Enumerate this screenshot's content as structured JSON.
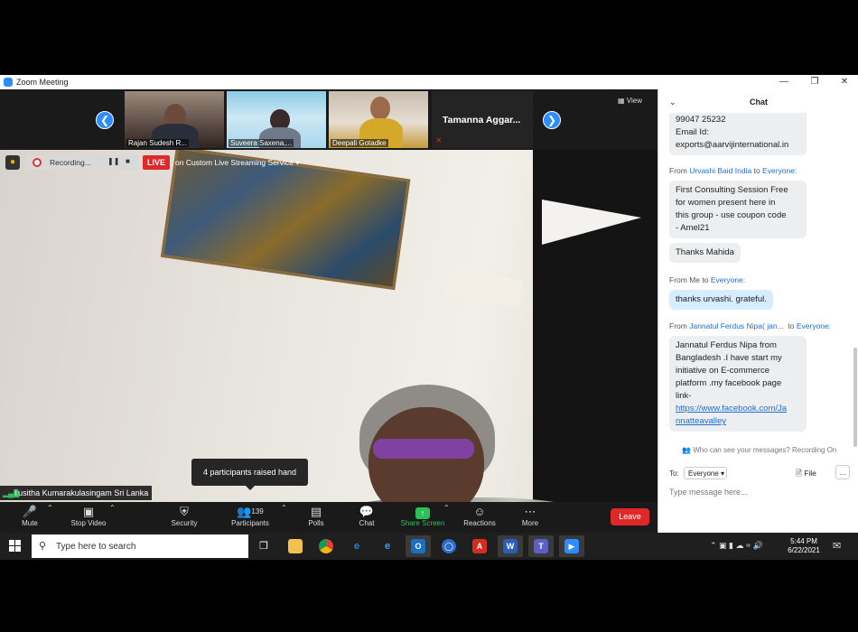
{
  "window": {
    "title": "Zoom Meeting"
  },
  "thumbnails": [
    {
      "name": "Rajan Sudesh R..."
    },
    {
      "name": "Suveera Saxena,..."
    },
    {
      "name": "Deepali Gotadke"
    },
    {
      "name": "Tamanna  Aggar..."
    }
  ],
  "view_label": "View",
  "recording": {
    "label": "Recording...",
    "live": "LIVE",
    "stream": "on Custom Live Streaming Service"
  },
  "active_speaker": "Tusitha Kumarakulasingam Sri Lanka",
  "raised_hand_tooltip": "4 participants raised hand",
  "toolbar": {
    "mute": "Mute",
    "stop_video": "Stop Video",
    "security": "Security",
    "participants": "Participants",
    "participants_count": "139",
    "polls": "Polls",
    "chat": "Chat",
    "share_screen": "Share Screen",
    "reactions": "Reactions",
    "more": "More",
    "leave": "Leave"
  },
  "chat": {
    "title": "Chat",
    "partial_message": {
      "lines": [
        "99047 25232",
        "Email Id:",
        "exports@aarvijinternational.in"
      ]
    },
    "messages": [
      {
        "from_label": "From",
        "sender": "Urvashi Baid India",
        "to_label": "to",
        "recipient": "Everyone:",
        "bubbles": [
          [
            "First Consulting Session Free",
            "for women present here in",
            "this group - use coupon code",
            "- Amel21"
          ],
          [
            "Thanks Mahida"
          ]
        ]
      },
      {
        "from_label": "From",
        "sender": "Me",
        "to_label": "to",
        "recipient": "Everyone:",
        "bubbles": [
          [
            "thanks urvashi. grateful."
          ]
        ]
      },
      {
        "from_label": "From",
        "sender": "Jannatul Ferdus Nipa( jan...",
        "to_label": "to",
        "recipient": "Everyone:",
        "bubbles": [
          [
            "Jannatul Ferdus Nipa from",
            "Bangladesh .I have start my",
            "initiative on E-commerce",
            "platform .my facebook page",
            "link-"
          ]
        ],
        "link_lines": [
          "https://www.facebook.com/Ja",
          "nnatteavalley"
        ]
      }
    ],
    "who_can_see": "Who can see your messages? Recording On",
    "to_label": "To:",
    "to_value": "Everyone",
    "file_label": "File",
    "more_label": "...",
    "input_placeholder": "Type message here..."
  },
  "taskbar": {
    "search_placeholder": "Type here to search",
    "time": "5:44 PM",
    "date": "6/22/2021"
  }
}
